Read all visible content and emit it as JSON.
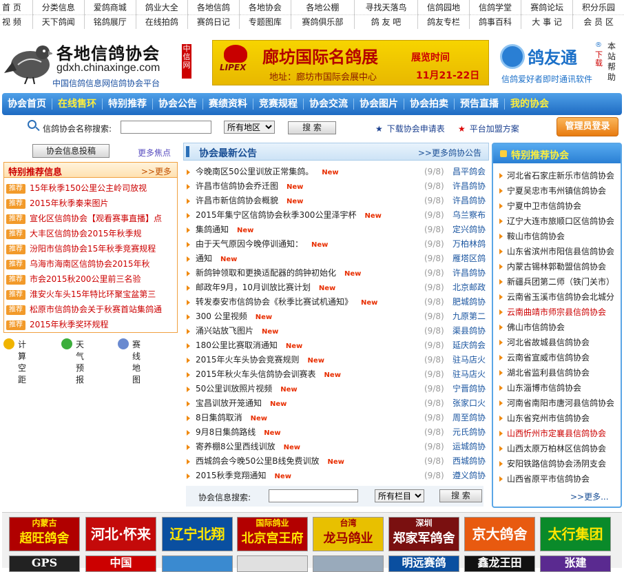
{
  "topnav": {
    "row1": [
      "首 页",
      "分类信息",
      "爱鸽商城",
      "鸽业大全",
      "各地信鸽",
      "各地协会",
      "各地公棚",
      "寻找天落鸟",
      "信鸽园地",
      "信鸽学堂",
      "赛鸽论坛",
      "积分乐园"
    ],
    "row2": [
      "视 频",
      "天下鸽闻",
      "铭鸽展厅",
      "在线拍鸽",
      "赛鸽日记",
      "专题图库",
      "赛鸽俱乐部",
      "鸽 友 吧",
      "鸽友专栏",
      "鸽事百科",
      "大 事 记",
      "会 员 区"
    ]
  },
  "header": {
    "logo_title": "各地信鸽协会",
    "logo_domain": "gdxh.chinaxinge.com",
    "logo_sub": "中国信鸽信息网信鸽协会平台",
    "red_tag": "中信网",
    "banner_title": "廊坊国际名鸽展",
    "banner_addr": "地址：廊坊市国际会展中心",
    "banner_time_label": "展览时间",
    "banner_date": "11月21-22日",
    "banner_brand": "LIPEX",
    "gyt_name": "鸽友通",
    "gyt_reg": "®",
    "gyt_dl": "下载",
    "gyt_slogan": "信鸽爱好者即时通讯软件",
    "gyt_side": "本站帮助"
  },
  "mainnav": [
    "协会首页",
    "在线售环",
    "特别推荐",
    "协会公告",
    "赛绩资料",
    "竞赛规程",
    "协会交流",
    "协会图片",
    "协会拍卖",
    "预告直播",
    "我的协会"
  ],
  "search": {
    "label": "信鸽协会名称搜索:",
    "region": "所有地区",
    "button": "搜  索",
    "link1": "下载协会申请表",
    "link2": "平台加盟方案",
    "admin": "管理员登录"
  },
  "left": {
    "submit_btn": "协会信息投稿",
    "more": "更多焦点",
    "rec_title": "特别推荐信息",
    "rec_more": "更多",
    "tag": "推荐",
    "items": [
      "15年秋季150公里公主岭司放视",
      "2015年秋季秦来图片",
      "宣化区信鸽协会【观看赛事直播】点",
      "大丰区信鸽协会2015年秋季规",
      "汾阳市信鸽协会15年秋季竞赛规程",
      "乌海市海南区信鸽协会2015年秋",
      "市会2015秋200公里前三名验",
      "淮安火车头15年特比环聚宝盆第三",
      "松原市信鸽协会关于秋赛首站集鸽通",
      "2015年秋季奖环规程"
    ],
    "tools": [
      "计算空距",
      "天气预报",
      "赛线地图"
    ]
  },
  "center": {
    "title": "协会最新公告",
    "more": ">>更多鸽协公告",
    "new_label": "New",
    "items": [
      {
        "t": "今晚南区50公里训放正常集鸽。",
        "d": "(9/8)",
        "s": "昌平鸽会"
      },
      {
        "t": "许昌市信鸽协会乔迁图",
        "d": "(9/8)",
        "s": "许昌鸽协"
      },
      {
        "t": "许昌市新信鸽协会概貌",
        "d": "(9/8)",
        "s": "许昌鸽协"
      },
      {
        "t": "2015年集宁区信鸽协会秋季300公里泽宇杯",
        "d": "(9/8)",
        "s": "乌兰察布"
      },
      {
        "t": "集鸽通知",
        "d": "(9/8)",
        "s": "定兴鸽协"
      },
      {
        "t": "由于天气原因今晚停训通知：",
        "d": "(9/8)",
        "s": "万柏林鸽"
      },
      {
        "t": "通知",
        "d": "(9/8)",
        "s": "雁塔区鸽"
      },
      {
        "t": "新鸽钟领取和更换适配器的鸽钟初始化",
        "d": "(9/8)",
        "s": "许昌鸽协"
      },
      {
        "t": "邮政年9月，10月训放比赛计划",
        "d": "(9/8)",
        "s": "北京邮政"
      },
      {
        "t": "转发泰安市信鸽协会《秋季比赛试机通知》",
        "d": "(9/8)",
        "s": "肥城鸽协"
      },
      {
        "t": "300 公里视频",
        "d": "(9/8)",
        "s": "九原第二"
      },
      {
        "t": "涌兴站放飞图片",
        "d": "(9/8)",
        "s": "渠县鸽协"
      },
      {
        "t": "180公里比赛取消通知",
        "d": "(9/8)",
        "s": "延庆鸽会"
      },
      {
        "t": "2015年火车头协会竞赛规则",
        "d": "(9/8)",
        "s": "驻马店火"
      },
      {
        "t": "2015年秋火车头信鸽协会训赛表",
        "d": "(9/8)",
        "s": "驻马店火"
      },
      {
        "t": "50公里训放照片视频",
        "d": "(9/8)",
        "s": "宁晋鸽协"
      },
      {
        "t": "宝昌训放开笼通知",
        "d": "(9/8)",
        "s": "张家口火"
      },
      {
        "t": "8日集鸽取消",
        "d": "(9/8)",
        "s": "周至鸽协"
      },
      {
        "t": "9月8日集鸽路线",
        "d": "(9/8)",
        "s": "元氏鸽协"
      },
      {
        "t": "寄养棚8公里西线训放",
        "d": "(9/8)",
        "s": "运城鸽协"
      },
      {
        "t": "西城鸽会今晚50公里B线免费训放",
        "d": "(9/8)",
        "s": "西城鸽协"
      },
      {
        "t": "2015秋季竞翔通知",
        "d": "(9/8)",
        "s": "遵义鸽协"
      }
    ],
    "search_label": "协会信息搜索:",
    "search_select": "所有栏目",
    "search_btn": "搜  索"
  },
  "right": {
    "title": "特别推荐协会",
    "more": ">>更多...",
    "items": [
      {
        "n": "河北省石家庄新乐市信鸽协会",
        "red": false
      },
      {
        "n": "宁夏吴忠市韦州镇信鸽协会",
        "red": false
      },
      {
        "n": "宁夏中卫市信鸽协会",
        "red": false
      },
      {
        "n": "辽宁大连市旅顺口区信鸽协会",
        "red": false
      },
      {
        "n": "鞍山市信鸽协会",
        "red": false
      },
      {
        "n": "山东省滨州市阳信县信鸽协会",
        "red": false
      },
      {
        "n": "内蒙古锡林郭勒盟信鸽协会",
        "red": false
      },
      {
        "n": "新疆兵团第二师（铁门关市）",
        "red": false
      },
      {
        "n": "云南省玉溪市信鸽协会北城分",
        "red": false
      },
      {
        "n": "云南曲靖市师宗县信鸽协会",
        "red": true
      },
      {
        "n": "佛山市信鸽协会",
        "red": false
      },
      {
        "n": "河北省故城县信鸽协会",
        "red": false
      },
      {
        "n": "云南省宣威市信鸽协会",
        "red": false
      },
      {
        "n": "湖北省监利县信鸽协会",
        "red": false
      },
      {
        "n": "山东淄博市信鸽协会",
        "red": false
      },
      {
        "n": "河南省南阳市唐河县信鸽协会",
        "red": false
      },
      {
        "n": "山东省兖州市信鸽协会",
        "red": false
      },
      {
        "n": "山西忻州市定襄县信鸽协会",
        "red": true
      },
      {
        "n": "山西太原万柏林区信鸽协会",
        "red": false
      },
      {
        "n": "安阳铁路信鸽协会汤阴支会",
        "red": false
      },
      {
        "n": "山西省原平市信鸽协会",
        "red": false
      }
    ]
  },
  "ads": {
    "row1": [
      {
        "t": "超旺鸽舍",
        "pre": "内蒙古",
        "bg": "#b00000",
        "fg": "#ffe600"
      },
      {
        "t": "河北·怀来",
        "pre": "",
        "bg": "#c40a0a",
        "fg": "#ffffff"
      },
      {
        "t": "辽宁北翔",
        "pre": "",
        "bg": "#0a4fa0",
        "fg": "#ffe600"
      },
      {
        "t": "北京宫王府",
        "pre": "国际鸽业",
        "bg": "#b30000",
        "fg": "#ffe600"
      },
      {
        "t": "龙马鸽业",
        "pre": "台湾",
        "bg": "#e8c000",
        "fg": "#a00000"
      },
      {
        "t": "郑家军鸽舍",
        "pre": "深圳",
        "bg": "#7a1010",
        "fg": "#ffffff"
      },
      {
        "t": "京大鸽舍",
        "pre": "",
        "bg": "#e85a10",
        "fg": "#ffffff"
      },
      {
        "t": "太行集团",
        "pre": "",
        "bg": "#0a8a2a",
        "fg": "#ffe600"
      }
    ],
    "row2": [
      "GPS",
      "中国",
      "",
      "",
      "",
      "明远赛鸽",
      "鑫龙王田",
      "张建"
    ]
  }
}
